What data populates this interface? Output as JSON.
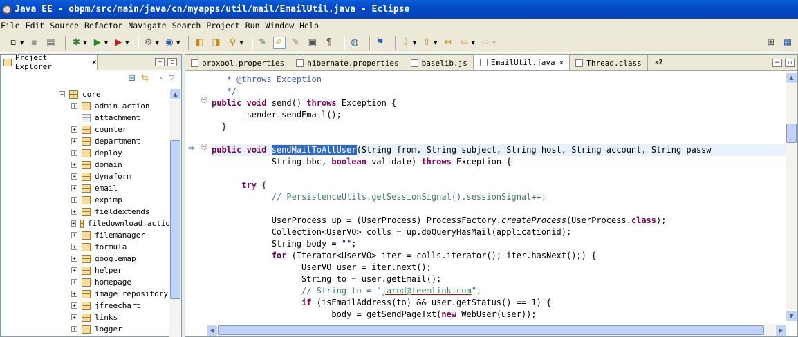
{
  "window": {
    "title": "Java EE - obpm/src/main/java/cn/myapps/util/mail/EmailUtil.java - Eclipse"
  },
  "menu": [
    "File",
    "Edit",
    "Source",
    "Refactor",
    "Navigate",
    "Search",
    "Project",
    "Run",
    "Window",
    "Help"
  ],
  "toolbar": {
    "icons": [
      "new-icon",
      "save-icon",
      "print-icon",
      "debug-icon",
      "run-icon",
      "external-tools-icon",
      "new-server-icon",
      "new-class-icon",
      "open-type-icon",
      "open-folder-icon",
      "search-icon",
      "toggle-breadcrumb-icon",
      "mark-occurrences-icon",
      "toggle-block-icon",
      "show-whitespace-icon",
      "globe-icon",
      "web-browser-icon",
      "next-annotation-icon",
      "previous-annotation-icon",
      "last-edit-icon",
      "back-icon",
      "forward-icon",
      "open-perspective-icon",
      "java-ee-perspective-icon"
    ]
  },
  "explorer": {
    "tab_label": "Project Explorer",
    "close_glyph": "×",
    "tree": [
      {
        "label": "core",
        "expander": "−",
        "indent": 86,
        "icon": "folder"
      },
      {
        "label": "admin.action",
        "expander": "+",
        "indent": 104,
        "icon": "package"
      },
      {
        "label": "attachment",
        "expander": "",
        "indent": 104,
        "icon": "package-empty"
      },
      {
        "label": "counter",
        "expander": "+",
        "indent": 104,
        "icon": "package"
      },
      {
        "label": "department",
        "expander": "+",
        "indent": 104,
        "icon": "package"
      },
      {
        "label": "deploy",
        "expander": "+",
        "indent": 104,
        "icon": "package"
      },
      {
        "label": "domain",
        "expander": "+",
        "indent": 104,
        "icon": "package"
      },
      {
        "label": "dynaform",
        "expander": "+",
        "indent": 104,
        "icon": "package"
      },
      {
        "label": "email",
        "expander": "+",
        "indent": 104,
        "icon": "package"
      },
      {
        "label": "expimp",
        "expander": "+",
        "indent": 104,
        "icon": "package"
      },
      {
        "label": "fieldextends",
        "expander": "+",
        "indent": 104,
        "icon": "package"
      },
      {
        "label": "filedownload.actio",
        "expander": "+",
        "indent": 104,
        "icon": "package"
      },
      {
        "label": "filemanager",
        "expander": "+",
        "indent": 104,
        "icon": "package"
      },
      {
        "label": "formula",
        "expander": "+",
        "indent": 104,
        "icon": "package"
      },
      {
        "label": "googlemap",
        "expander": "+",
        "indent": 104,
        "icon": "package"
      },
      {
        "label": "helper",
        "expander": "+",
        "indent": 104,
        "icon": "package"
      },
      {
        "label": "homepage",
        "expander": "+",
        "indent": 104,
        "icon": "package"
      },
      {
        "label": "image.repository",
        "expander": "+",
        "indent": 104,
        "icon": "package"
      },
      {
        "label": "jfreechart",
        "expander": "+",
        "indent": 104,
        "icon": "package"
      },
      {
        "label": "links",
        "expander": "+",
        "indent": 104,
        "icon": "package"
      },
      {
        "label": "logger",
        "expander": "+",
        "indent": 104,
        "icon": "package"
      }
    ]
  },
  "editor": {
    "tabs": [
      {
        "label": "proxool.properties",
        "active": false,
        "close": ""
      },
      {
        "label": "hibernate.properties",
        "active": false,
        "close": ""
      },
      {
        "label": "baselib.js",
        "active": false,
        "close": ""
      },
      {
        "label": "EmailUtil.java",
        "active": true,
        "close": "×"
      },
      {
        "label": "Thread.class",
        "active": false,
        "close": ""
      }
    ],
    "overflow_label": "»2",
    "code": [
      [
        [
          "jd",
          "   * @throws Exception"
        ]
      ],
      [
        [
          "jd",
          "   */"
        ]
      ],
      [
        [
          "kw",
          "public"
        ],
        [
          "",
          " "
        ],
        [
          "kw",
          "void"
        ],
        [
          "",
          " send() "
        ],
        [
          "kw",
          "throws"
        ],
        [
          "",
          " Exception {"
        ]
      ],
      [
        [
          "",
          "      _sender.sendEmail();"
        ]
      ],
      [
        [
          "",
          "  }"
        ]
      ],
      [
        [
          "",
          ""
        ]
      ],
      [
        [
          "kw",
          "public"
        ],
        [
          "",
          " "
        ],
        [
          "kw",
          "void"
        ],
        [
          "",
          " "
        ],
        [
          "sel",
          "sendMailToAllUser"
        ],
        [
          "",
          "(String from, String subject, String host, String account, String passw"
        ]
      ],
      [
        [
          "",
          "            String bbc, "
        ],
        [
          "kw",
          "boolean"
        ],
        [
          "",
          " validate) "
        ],
        [
          "kw",
          "throws"
        ],
        [
          "",
          " Exception {"
        ]
      ],
      [
        [
          "",
          ""
        ]
      ],
      [
        [
          "",
          "      "
        ],
        [
          "kw",
          "try"
        ],
        [
          "",
          " {"
        ]
      ],
      [
        [
          "",
          "            "
        ],
        [
          "cm",
          "// PersistenceUtils.getSessionSignal().sessionSignal++;"
        ]
      ],
      [
        [
          "",
          ""
        ]
      ],
      [
        [
          "",
          "            UserProcess up = (UserProcess) ProcessFactory."
        ],
        [
          "it",
          "createProcess"
        ],
        [
          "",
          "(UserProcess."
        ],
        [
          "kw",
          "class"
        ],
        [
          "",
          ");"
        ]
      ],
      [
        [
          "",
          "            Collection<UserVO> colls = up.doQueryHasMail(applicationid);"
        ]
      ],
      [
        [
          "",
          "            String body = "
        ],
        [
          "st",
          "\"\""
        ],
        [
          "",
          ";"
        ]
      ],
      [
        [
          "",
          "            "
        ],
        [
          "kw",
          "for"
        ],
        [
          "",
          " (Iterator<UserVO> iter = colls.iterator(); iter.hasNext();) {"
        ]
      ],
      [
        [
          "",
          "                  UserVO user = iter.next();"
        ]
      ],
      [
        [
          "",
          "                  String to = user.getEmail();"
        ]
      ],
      [
        [
          "",
          "                  "
        ],
        [
          "cm",
          "// String to = \""
        ],
        [
          "cml",
          "jarod@teemlink.com"
        ],
        [
          "cm",
          "\";"
        ]
      ],
      [
        [
          "",
          "                  "
        ],
        [
          "kw",
          "if"
        ],
        [
          "",
          " (isEmailAddress(to) && user.getStatus() == 1) {"
        ]
      ],
      [
        [
          "",
          "                        body = getSendPageTxt("
        ],
        [
          "kw",
          "new"
        ],
        [
          "",
          " WebUser(user));"
        ]
      ]
    ]
  }
}
